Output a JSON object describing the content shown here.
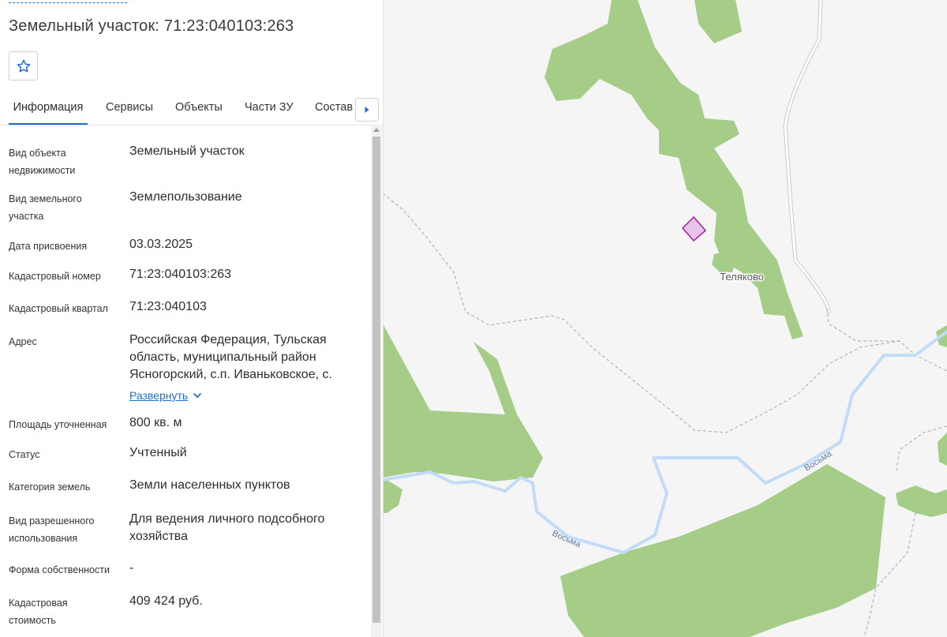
{
  "panel": {
    "title": "Земельный участок: 71:23:040103:263",
    "tabs": [
      {
        "label": "Информация",
        "active": true
      },
      {
        "label": "Сервисы"
      },
      {
        "label": "Объекты"
      },
      {
        "label": "Части ЗУ"
      },
      {
        "label": "Состав"
      }
    ],
    "rows": [
      {
        "label": "Вид объекта недвижимости",
        "value": "Земельный участок"
      },
      {
        "label": "Вид земельного участка",
        "value": "Землепользование"
      },
      {
        "label": "Дата присвоения",
        "value": "03.03.2025"
      },
      {
        "label": "Кадастровый номер",
        "value": "71:23:040103:263"
      },
      {
        "label": "Кадастровый квартал",
        "value": "71:23:040103"
      },
      {
        "label": "Адрес",
        "value": "Российская Федерация, Тульская область, муниципальный район Ясногорский, с.п. Иваньковское, с."
      },
      {
        "label": "Площадь уточненная",
        "value": "800 кв. м"
      },
      {
        "label": "Статус",
        "value": "Учтенный"
      },
      {
        "label": "Категория земель",
        "value": "Земли населенных пунктов"
      },
      {
        "label": "Вид разрешенного использования",
        "value": "Для ведения личного подсобного хозяйства"
      },
      {
        "label": "Форма собственности",
        "value": "-"
      },
      {
        "label": "Кадастровая стоимость",
        "value": "409 424 руб."
      }
    ],
    "expand_label": "Развернуть"
  },
  "map": {
    "village_label": "Теляково",
    "river_label_1": "Восьма",
    "river_label_2": "Восьма",
    "colors": {
      "background": "#f5f5f6",
      "forest": "#a6cd87",
      "river": "#c2dcf7",
      "boundary": "#b4b4b4",
      "parcel_fill": "#e7c3e6",
      "parcel_stroke": "#a21fa3",
      "accent": "#1f6fd1"
    }
  },
  "icons": {
    "favorite": "star-outline-icon",
    "tabs_next": "triangle-right-icon",
    "expand": "chevron-down-icon"
  }
}
